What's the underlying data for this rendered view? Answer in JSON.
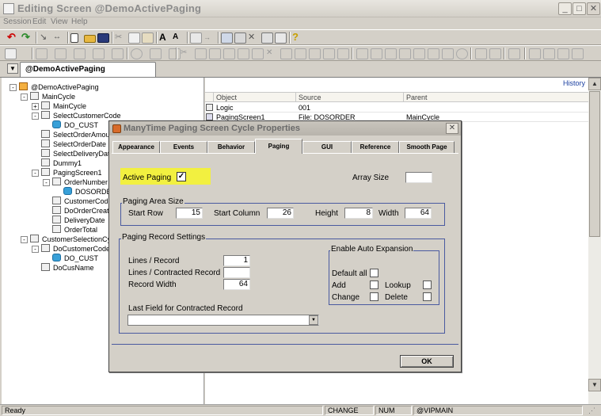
{
  "window": {
    "title": "Editing Screen @DemoActivePaging"
  },
  "menu": [
    "Session",
    "Edit",
    "View",
    "Help"
  ],
  "tab": {
    "label": "@DemoActivePaging"
  },
  "tree": [
    {
      "label": "@DemoActivePaging",
      "level": 0,
      "expand": "-",
      "icon": "root-icon"
    },
    {
      "label": "MainCycle",
      "level": 1,
      "expand": "-",
      "icon": "cycle-icon"
    },
    {
      "label": "MainCycle",
      "level": 2,
      "expand": "+",
      "icon": "cycle-icon"
    },
    {
      "label": "SelectCustomerCode",
      "level": 2,
      "expand": "-",
      "icon": "field-icon"
    },
    {
      "label": "DO_CUST",
      "level": 3,
      "expand": "",
      "icon": "db-icon"
    },
    {
      "label": "SelectOrderAmount",
      "level": 2,
      "expand": "",
      "icon": "field-icon"
    },
    {
      "label": "SelectOrderDate",
      "level": 2,
      "expand": "",
      "icon": "field-icon"
    },
    {
      "label": "SelectDeliveryDate",
      "level": 2,
      "expand": "",
      "icon": "field-icon"
    },
    {
      "label": "Dummy1",
      "level": 2,
      "expand": "",
      "icon": "field-icon"
    },
    {
      "label": "PagingScreen1",
      "level": 2,
      "expand": "-",
      "icon": "screen-icon"
    },
    {
      "label": "OrderNumber",
      "level": 3,
      "expand": "-",
      "icon": "field-icon"
    },
    {
      "label": "DOSORDER",
      "level": 4,
      "expand": "",
      "icon": "db-icon"
    },
    {
      "label": "CustomerCode",
      "level": 3,
      "expand": "",
      "icon": "field-icon"
    },
    {
      "label": "DoOrderCreate",
      "level": 3,
      "expand": "",
      "icon": "field-icon"
    },
    {
      "label": "DeliveryDate",
      "level": 3,
      "expand": "",
      "icon": "field-icon"
    },
    {
      "label": "OrderTotal",
      "level": 3,
      "expand": "",
      "icon": "field-icon"
    },
    {
      "label": "CustomerSelectionCycle",
      "level": 1,
      "expand": "-",
      "icon": "search-icon"
    },
    {
      "label": "DoCustomerCode",
      "level": 2,
      "expand": "-",
      "icon": "field-icon"
    },
    {
      "label": "DO_CUST",
      "level": 3,
      "expand": "",
      "icon": "db-icon"
    },
    {
      "label": "DoCusName",
      "level": 2,
      "expand": "",
      "icon": "field-icon"
    }
  ],
  "grid": {
    "history_label": "History",
    "headers": [
      "Object",
      "Source",
      "Parent"
    ],
    "rows": [
      [
        "Logic",
        "001",
        ""
      ],
      [
        "PagingScreen1",
        "File: DOSORDER",
        "MainCycle"
      ]
    ]
  },
  "dialog": {
    "title": "ManyTime Paging Screen Cycle Properties",
    "tabs": [
      "Appearance",
      "Events",
      "Behavior",
      "Paging",
      "GUI",
      "Reference",
      "Smooth Page"
    ],
    "active_tab": "Paging",
    "active_paging": {
      "label": "Active Paging",
      "checked": true,
      "check_glyph": "✓"
    },
    "array_size": {
      "label": "Array Size",
      "value": ""
    },
    "area_group": "Paging Area Size",
    "start_row": {
      "label": "Start Row",
      "value": "15"
    },
    "start_column": {
      "label": "Start Column",
      "value": "26"
    },
    "height": {
      "label": "Height",
      "value": "8"
    },
    "width": {
      "label": "Width",
      "value": "64"
    },
    "record_group": "Paging Record Settings",
    "lines_per_record": {
      "label": "Lines / Record",
      "value": "1"
    },
    "lines_contracted": {
      "label": "Lines / Contracted Record",
      "value": ""
    },
    "record_width": {
      "label": "Record Width",
      "value": "64"
    },
    "last_field": {
      "label": "Last Field for Contracted Record",
      "value": ""
    },
    "auto_group": "Enable Auto Expansion",
    "default_all": "Default all",
    "add": "Add",
    "change": "Change",
    "lookup": "Lookup",
    "delete": "Delete",
    "ok": "OK"
  },
  "status": {
    "ready": "Ready",
    "mode": "CHANGE",
    "num": "NUM",
    "server": "@VIPMAIN"
  }
}
